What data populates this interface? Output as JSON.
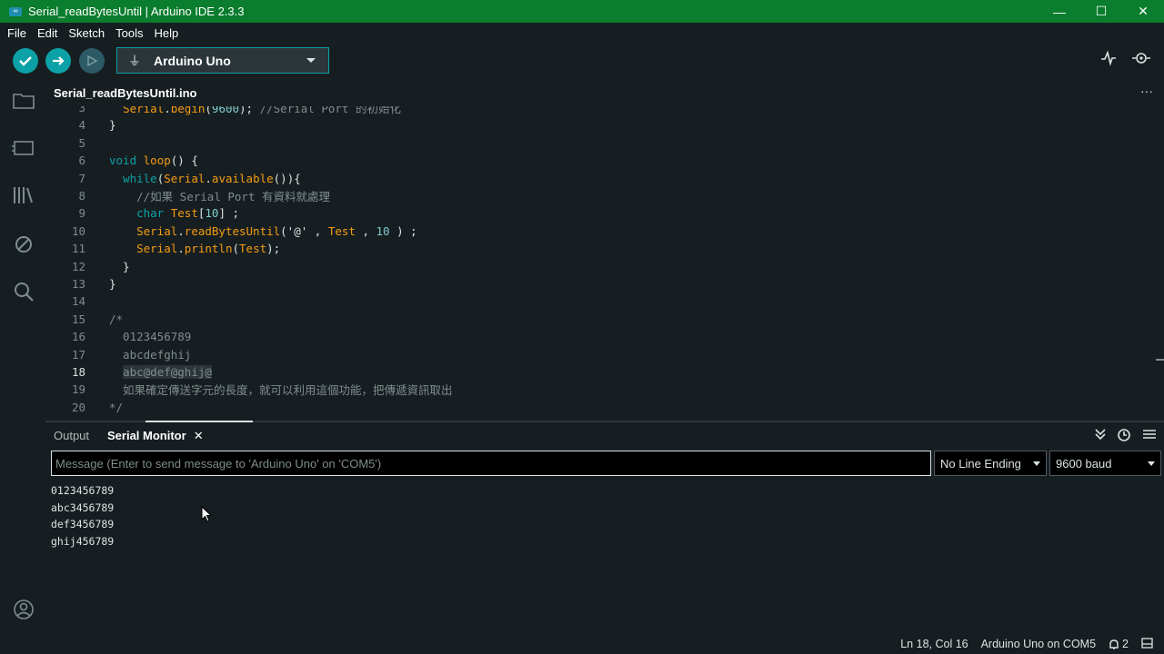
{
  "window": {
    "title": "Serial_readBytesUntil | Arduino IDE 2.3.3",
    "minimize": "—",
    "maximize": "☐",
    "close": "✕"
  },
  "menu": [
    "File",
    "Edit",
    "Sketch",
    "Tools",
    "Help"
  ],
  "toolbar": {
    "board": "Arduino Uno"
  },
  "colors": {
    "titlebar": "#0a7d2e",
    "accent": "#0ca1a6",
    "keyword": "#0ca1a6",
    "function": "#f39c12",
    "comment": "#7f8c8d",
    "background": "#171e21"
  },
  "tab": {
    "filename": "Serial_readBytesUntil.ino",
    "more": "···"
  },
  "editor": {
    "lines": [
      {
        "n": "3",
        "text": "  Serial.begin(9600); //Serial Port 的初始化"
      },
      {
        "n": "4",
        "text": "}"
      },
      {
        "n": "5",
        "text": ""
      },
      {
        "n": "6",
        "text": "void loop() {"
      },
      {
        "n": "7",
        "text": "  while(Serial.available()){"
      },
      {
        "n": "8",
        "text": "    //如果 Serial Port 有資料就處理"
      },
      {
        "n": "9",
        "text": "    char Test[10] ;"
      },
      {
        "n": "10",
        "text": "    Serial.readBytesUntil('@' , Test , 10 ) ;"
      },
      {
        "n": "11",
        "text": "    Serial.println(Test);"
      },
      {
        "n": "12",
        "text": "  }"
      },
      {
        "n": "13",
        "text": "}"
      },
      {
        "n": "14",
        "text": ""
      },
      {
        "n": "15",
        "text": "/*"
      },
      {
        "n": "16",
        "text": "  0123456789"
      },
      {
        "n": "17",
        "text": "  abcdefghij"
      },
      {
        "n": "18",
        "text": "  abc@def@ghij@"
      },
      {
        "n": "19",
        "text": "  如果確定傳送字元的長度，就可以利用這個功能，把傳遞資訊取出"
      },
      {
        "n": "20",
        "text": "*/"
      },
      {
        "n": "21",
        "text": ""
      }
    ]
  },
  "panel": {
    "tab_output": "Output",
    "tab_serial": "Serial Monitor",
    "close": "✕",
    "input_placeholder": "Message (Enter to send message to 'Arduino Uno' on 'COM5')",
    "line_ending": "No Line Ending",
    "baud": "9600 baud",
    "output": [
      "0123456789",
      "abc3456789",
      "def3456789",
      "ghij456789"
    ]
  },
  "status": {
    "position": "Ln 18, Col 16",
    "board": "Arduino Uno on COM5",
    "notifications": "2"
  }
}
